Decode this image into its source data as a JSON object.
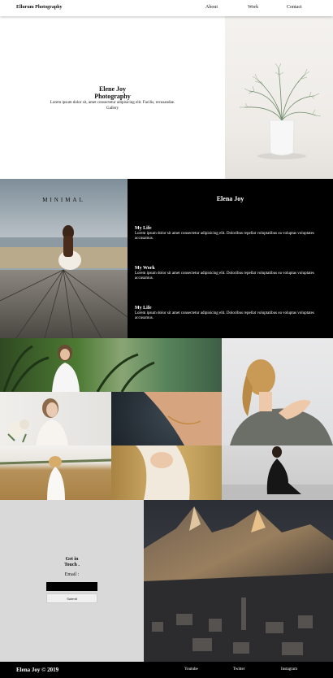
{
  "nav": {
    "brand": "Ellurum Photography",
    "links": [
      "About",
      "Work",
      "Contact"
    ]
  },
  "hero": {
    "title_line1": "Elene Joy",
    "title_line2": "Photography",
    "subtitle": "Lorem ipsum dolor sit, amet consectetur adipisicing elit. Facilis, recusandae.",
    "gallery_label": "Gallery"
  },
  "about": {
    "image_caption": "MINIMAL",
    "name": "Elena Joy",
    "sections": [
      {
        "heading": "My Life",
        "text": "Lorem ipsum dolor sit amet consectetur adipisicing elit. Doloribus repellat voluptatibus ea voluptas voluptates accusamus."
      },
      {
        "heading": "My Work",
        "text": "Lorem ipsum dolor sit amet consectetur adipisicing elit. Doloribus repellat voluptatibus ea voluptas voluptates accusamus."
      },
      {
        "heading": "My Life",
        "text": "Lorem ipsum dolor sit amet consectetur adipisicing elit. Doloribus repellat voluptatibus ea voluptas voluptates accusamus."
      }
    ]
  },
  "contact": {
    "title_line1": "Get in",
    "title_line2": "Touch .",
    "email_label": "Email :",
    "submit_label": "Submit"
  },
  "footer": {
    "copyright": "Elena Joy © 2019",
    "links": [
      "Youtube",
      "Twitter",
      "Instagram"
    ]
  },
  "colors": {
    "dark": "#000000",
    "contact_bg": "#d9d9d9"
  }
}
